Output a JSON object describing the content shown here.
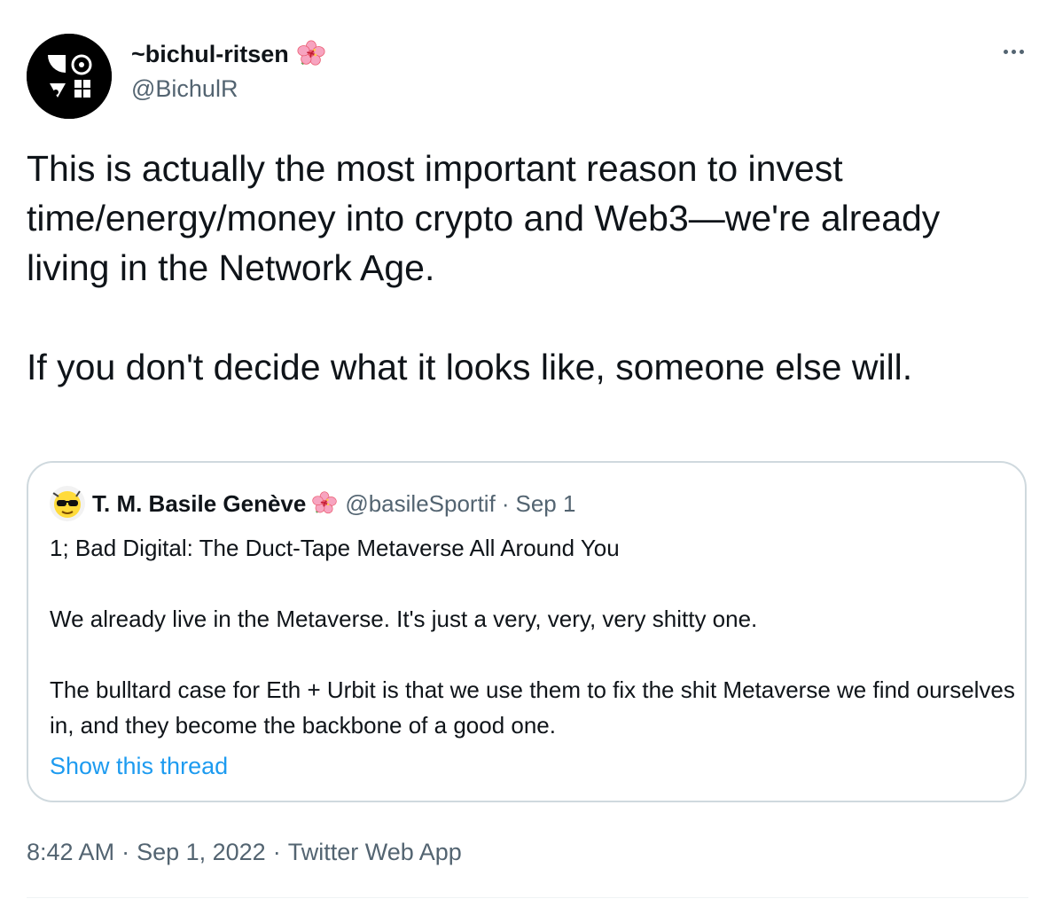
{
  "author": {
    "display_name": "~bichul-ritsen",
    "handle": "@BichulR",
    "avatar_icon": "urbit-sigil-avatar",
    "badge_icon": "hibiscus-flower-icon"
  },
  "tweet": {
    "text": "This is actually the most important reason to invest time/energy/money into crypto and Web3—we're already living in the Network Age.\n\nIf you don't decide what it looks like, someone else will."
  },
  "quoted_tweet": {
    "display_name": "T. M. Basile Genève",
    "handle": "@basileSportif",
    "separator": "·",
    "date": "Sep 1",
    "text": "1; Bad Digital: The Duct-Tape Metaverse All Around You\n\nWe already live in the Metaverse. It's just a very, very, very shitty one.\n\nThe bulltard case for Eth + Urbit is that we use them to fix the shit Metaverse we find ourselves in, and they become the backbone of a good one.",
    "show_thread_label": "Show this thread"
  },
  "meta": {
    "time": "8:42 AM",
    "separator": "·",
    "date": "Sep 1, 2022",
    "source": "Twitter Web App"
  },
  "colors": {
    "text_primary": "#0f1419",
    "text_secondary": "#536471",
    "link": "#1d9bf0",
    "border": "#cfd9de"
  }
}
